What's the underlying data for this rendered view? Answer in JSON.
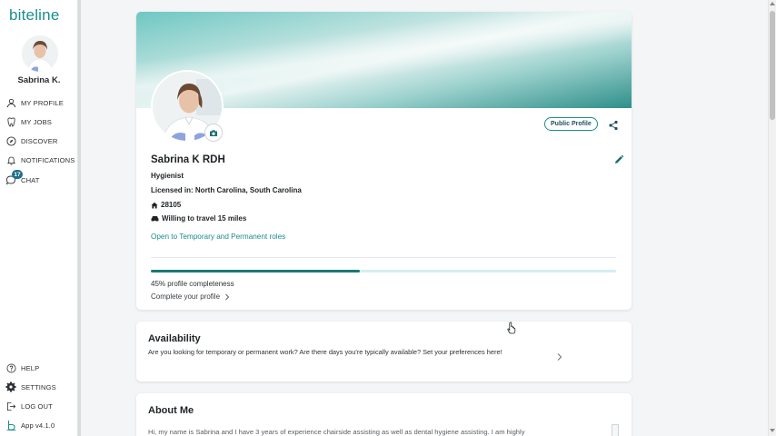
{
  "app": {
    "logo_text": "biteline",
    "version_label": "App v4.1.0"
  },
  "user": {
    "name": "Sabrina K."
  },
  "nav": {
    "items": [
      {
        "label": "MY PROFILE",
        "icon": "person-icon"
      },
      {
        "label": "MY JOBS",
        "icon": "tooth-icon"
      },
      {
        "label": "DISCOVER",
        "icon": "compass-icon"
      },
      {
        "label": "NOTIFICATIONS",
        "icon": "bell-icon"
      },
      {
        "label": "CHAT",
        "icon": "chat-bubble-icon",
        "badge": "17"
      }
    ],
    "bottom": [
      {
        "label": "HELP",
        "icon": "help-circle-icon"
      },
      {
        "label": "SETTINGS",
        "icon": "gear-icon"
      },
      {
        "label": "LOG OUT",
        "icon": "logout-icon"
      }
    ]
  },
  "profile": {
    "full_name": "Sabrina K RDH",
    "role": "Hygienist",
    "licensed": "Licensed in: North Carolina, South Carolina",
    "zip": "28105",
    "travel": "Willing to travel 15 miles",
    "roles_link": "Open to Temporary and Permanent roles",
    "public_profile_label": "Public Profile",
    "completeness_text": "45% profile completeness",
    "completeness_value": 45,
    "complete_link": "Complete your profile"
  },
  "availability": {
    "title": "Availability",
    "description": "Are you looking for temporary or permanent work? Are there days you're typically available? Set your preferences here!"
  },
  "about": {
    "title": "About Me",
    "text": "Hi, my name is Sabrina and I have 3 years of experience chairside assisting as well as dental hygiene assisting. I am highly"
  },
  "colors": {
    "brand": "#1a8f8c",
    "progress_fill": "#1a7a76",
    "progress_track": "#d5eef2",
    "badge": "#1d6f8a"
  }
}
